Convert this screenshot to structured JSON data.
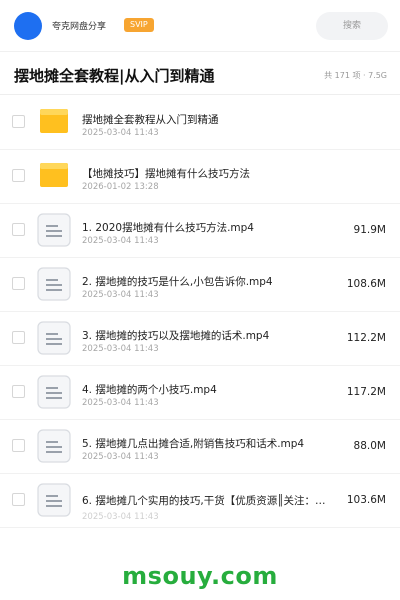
{
  "header": {
    "share_name": "夸克网盘分享",
    "vip_label": "SVIP",
    "search_placeholder": "搜索"
  },
  "folder": {
    "title": "摆地摊全套教程|从入门到精通",
    "meta": "共 171 项 · 7.5G"
  },
  "files": [
    {
      "type": "folder",
      "name": "摆地摊全套教程从入门到精通",
      "date": "2025-03-04 11:43",
      "size": ""
    },
    {
      "type": "folder",
      "name": "【地摊技巧】摆地摊有什么技巧方法",
      "date": "2026-01-02 13:28",
      "size": ""
    },
    {
      "type": "file",
      "name": "1. 2020摆地摊有什么技巧方法.mp4",
      "date": "2025-03-04 11:43",
      "size": "91.9M"
    },
    {
      "type": "file",
      "name": "2. 摆地摊的技巧是什么,小包告诉你.mp4",
      "date": "2025-03-04 11:43",
      "size": "108.6M"
    },
    {
      "type": "file",
      "name": "3. 摆地摊的技巧以及摆地摊的话术.mp4",
      "date": "2025-03-04 11:43",
      "size": "112.2M"
    },
    {
      "type": "file",
      "name": "4. 摆地摊的两个小技巧.mp4",
      "date": "2025-03-04 11:43",
      "size": "117.2M"
    },
    {
      "type": "file",
      "name": "5. 摆地摊几点出摊合适,附销售技巧和话术.mp4",
      "date": "2025-03-04 11:43",
      "size": "88.0M"
    },
    {
      "type": "file",
      "name": "6. 摆地摊几个实用的技巧,干货【优质资源║关注：…",
      "date": "2025-03-04 11:43",
      "size": "103.6M"
    }
  ],
  "watermark": "msouy.com",
  "colors": {
    "avatar": "#1e6ff1",
    "vip_badge": "#f7a531",
    "folder_icon": "#ffc01f",
    "watermark": "#27ad3d"
  }
}
